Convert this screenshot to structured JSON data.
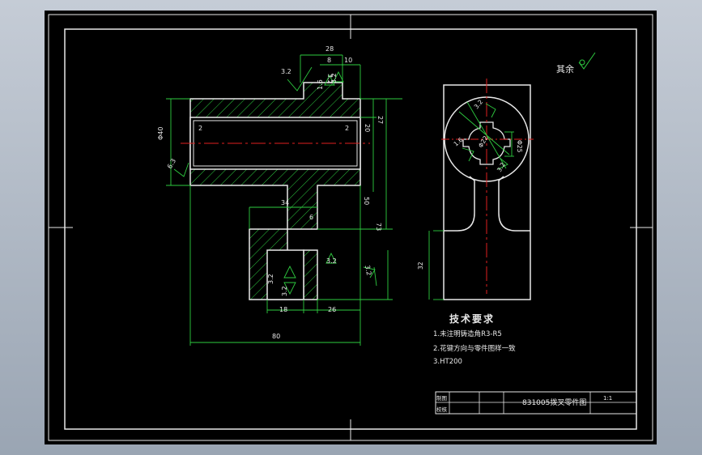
{
  "drawing": {
    "title_block": {
      "drawing_title": "831005拨叉零件图",
      "scale": "1:1",
      "row_label_1": "制图",
      "row_label_2": "校核"
    },
    "tech_requirements": {
      "heading": "技术要求",
      "items": [
        "1.未注明铸造角R3-R5",
        "2.花键方向与零件图样一致",
        "3.HT200"
      ]
    },
    "roughness_note": "其余",
    "front_view_dims": {
      "d28": "28",
      "d8": "8",
      "d10": "10",
      "d27": "27",
      "d20": "20",
      "d50": "50",
      "d73": "73",
      "d34": "34",
      "d6": "6",
      "d18": "18",
      "d26": "26",
      "d80": "80",
      "d2_left": "2",
      "d2_right": "2",
      "dia40": "Φ40",
      "r1": "3.2",
      "r2": "3.2",
      "r3": "6.3",
      "r4": "3.2",
      "r5": "3.2",
      "r6": "3.2",
      "r7": "3.2",
      "r8": "1.6",
      "r9": "3.2"
    },
    "side_view_dims": {
      "d32": "32",
      "spline_inner": "Φ22",
      "spline_outer": "Φ25",
      "r1": "3.2",
      "r2": "1.6",
      "r3": "3.2"
    }
  }
}
